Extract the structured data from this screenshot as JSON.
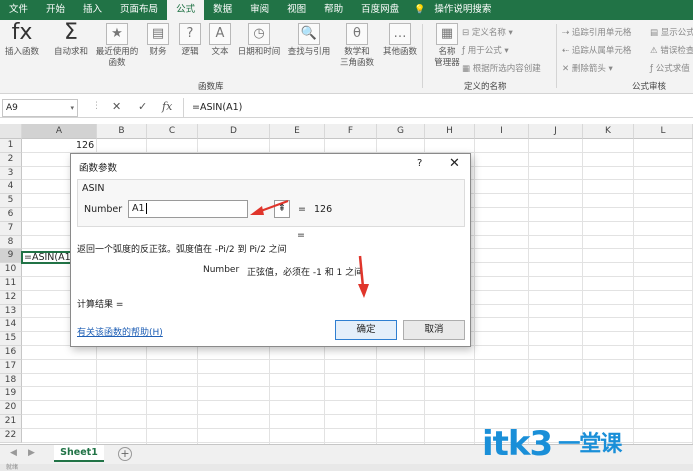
{
  "menu": {
    "tabs": [
      "文件",
      "开始",
      "插入",
      "页面布局",
      "公式",
      "数据",
      "审阅",
      "视图",
      "帮助",
      "百度网盘",
      "操作说明搜索"
    ],
    "active": "公式"
  },
  "ribbon": {
    "buttons": [
      {
        "icon": "fx",
        "label1": "插入函数",
        "label2": ""
      },
      {
        "icon": "Σ",
        "label1": "自动求和",
        "label2": ""
      },
      {
        "icon": "★",
        "label1": "最近使用的",
        "label2": "函数"
      },
      {
        "icon": "▤",
        "label1": "财务",
        "label2": ""
      },
      {
        "icon": "?",
        "label1": "逻辑",
        "label2": ""
      },
      {
        "icon": "A",
        "label1": "文本",
        "label2": ""
      },
      {
        "icon": "◷",
        "label1": "日期和时间",
        "label2": ""
      },
      {
        "icon": "🔍",
        "label1": "查找与引用",
        "label2": ""
      },
      {
        "icon": "θ",
        "label1": "数学和",
        "label2": "三角函数"
      },
      {
        "icon": "…",
        "label1": "其他函数",
        "label2": ""
      },
      {
        "icon": "▦",
        "label1": "名称",
        "label2": "管理器"
      }
    ],
    "names_group": [
      "定义名称",
      "用于公式",
      "根据所选内容创建"
    ],
    "audit_group": [
      "追踪引用单元格",
      "追踪从属单元格",
      "删除箭头",
      "显示公式",
      "错误检查",
      "公式求值"
    ],
    "group_labels": [
      "函数库",
      "定义的名称",
      "公式审核"
    ]
  },
  "formula_bar": {
    "name_box": "A9",
    "formula": "=ASIN(A1)",
    "fx": "fx"
  },
  "grid": {
    "columns": [
      "A",
      "B",
      "C",
      "D",
      "E",
      "F",
      "G",
      "H",
      "I",
      "J",
      "K",
      "L"
    ],
    "rows": [
      "1",
      "2",
      "3",
      "4",
      "5",
      "6",
      "7",
      "8",
      "9",
      "10",
      "11",
      "12",
      "13",
      "14",
      "15",
      "16",
      "17",
      "18",
      "19",
      "20",
      "21",
      "22"
    ],
    "a1": "126",
    "a9": "=ASIN(A1)"
  },
  "dialog": {
    "title": "函数参数",
    "help": "?",
    "close": "✕",
    "function_name": "ASIN",
    "arg_label": "Number",
    "arg_value": "A1",
    "arg_result_eq": "=",
    "arg_result": "126",
    "result_eq2": "=",
    "description": "返回一个弧度的反正弦。弧度值在 -Pi/2 到 Pi/2 之间",
    "param_desc_name": "Number",
    "param_desc": "正弦值，必须在 -1 和 1 之间",
    "calc_result": "计算结果 =",
    "help_link": "有关该函数的帮助(H)",
    "ok": "确定",
    "cancel": "取消"
  },
  "sheets": {
    "tabs": [
      "Sheet1"
    ],
    "add": "+"
  },
  "status": {
    "text": "就绪"
  },
  "watermark": {
    "text": "itk3",
    "suffix": "一堂课"
  },
  "colors": {
    "excel_green": "#217346",
    "link_blue": "#1f5fb5",
    "arrow_red": "#e0352b",
    "watermark_blue": "#1a8fd8"
  }
}
